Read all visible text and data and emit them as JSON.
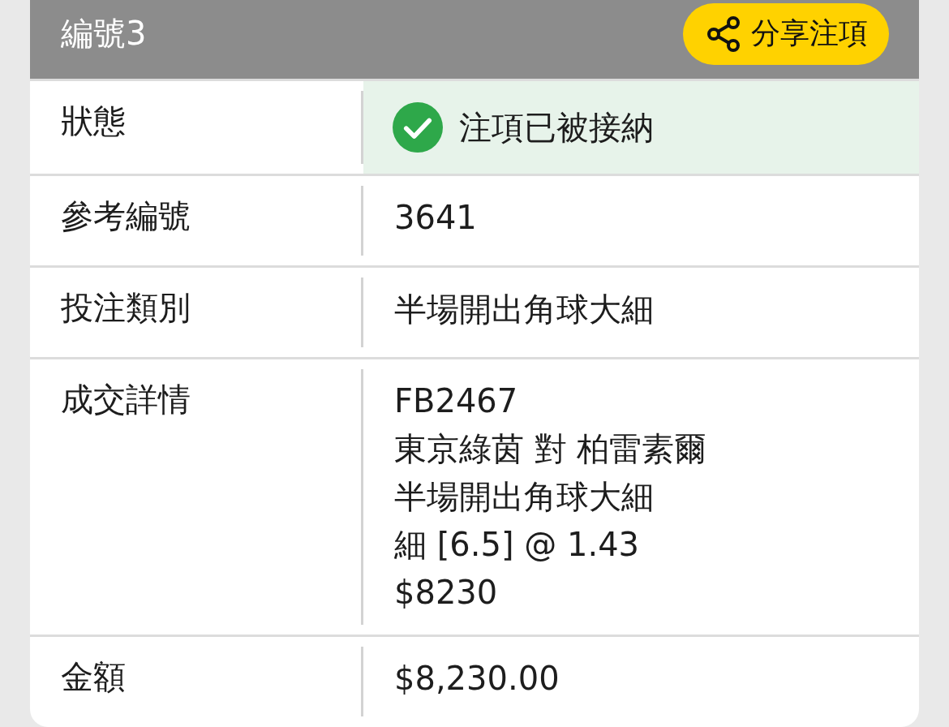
{
  "header": {
    "title": "編號3",
    "share_button": "分享注項"
  },
  "rows": [
    {
      "label": "狀態",
      "kind": "status",
      "accepted": true,
      "lines": [
        "注項已被接納"
      ]
    },
    {
      "label": "參考編號",
      "kind": "text",
      "lines": [
        "3641"
      ]
    },
    {
      "label": "投注類別",
      "kind": "text",
      "lines": [
        "半場開出角球大細"
      ]
    },
    {
      "label": "成交詳情",
      "kind": "text",
      "lines": [
        "FB2467",
        "東京綠茵 對 柏雷素爾",
        "半場開出角球大細",
        "細 [6.5] @ 1.43",
        "$8230"
      ]
    },
    {
      "label": "金額",
      "kind": "text",
      "lines": [
        "$8,230.00"
      ]
    }
  ]
}
